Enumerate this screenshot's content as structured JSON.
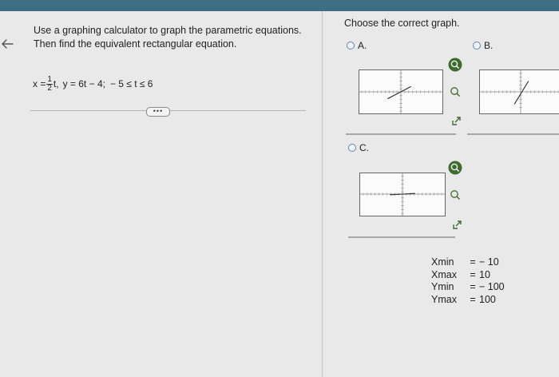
{
  "question": {
    "instructions": "Use a graphing calculator to graph the parametric equations. Then find the equivalent rectangular equation.",
    "equation": {
      "x_prefix": "x =",
      "frac_num": "1",
      "frac_den": "2",
      "x_suffix": "t,",
      "y_part": "y = 6t − 4;",
      "domain": "− 5 ≤ t ≤ 6"
    },
    "more_label": "•••"
  },
  "answer": {
    "prompt": "Choose the correct graph.",
    "options": [
      {
        "label": "A."
      },
      {
        "label": "B."
      },
      {
        "label": "C."
      }
    ],
    "window": [
      {
        "key": "Xmin",
        "value": "− 10"
      },
      {
        "key": "Xmax",
        "value": "10"
      },
      {
        "key": "Ymin",
        "value": "− 100"
      },
      {
        "key": "Ymax",
        "value": "100"
      }
    ]
  },
  "colors": {
    "topbar": "#3d6f84",
    "radio": "#5b8ab5",
    "zoom_in_icon": "#3e6b2e"
  },
  "icons": [
    "back-arrow-icon",
    "zoom-in-icon",
    "zoom-out-icon",
    "expand-icon"
  ]
}
